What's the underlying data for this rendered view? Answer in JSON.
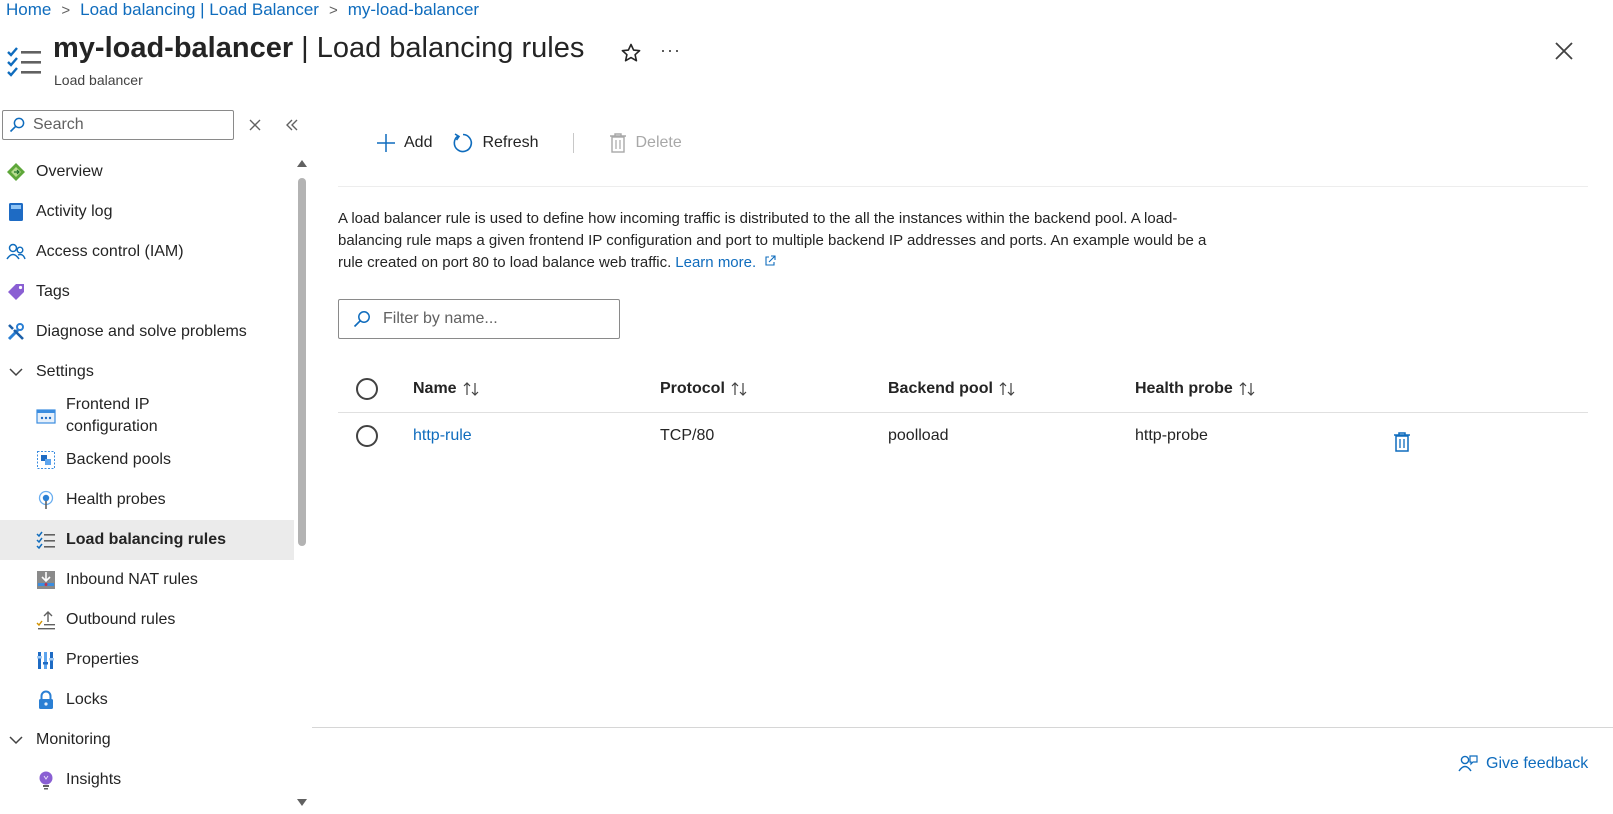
{
  "breadcrumb": [
    {
      "label": "Home"
    },
    {
      "label": "Load balancing | Load Balancer"
    },
    {
      "label": "my-load-balancer"
    }
  ],
  "header": {
    "resource_name": "my-load-balancer",
    "separator": "|",
    "page_name": "Load balancing rules",
    "subtitle": "Load balancer",
    "more_label": "···",
    "icon": "list-checks-icon"
  },
  "sidebar": {
    "search_placeholder": "Search",
    "items": [
      {
        "label": "Overview",
        "icon": "overview-diamond-icon"
      },
      {
        "label": "Activity log",
        "icon": "activity-log-book-icon"
      },
      {
        "label": "Access control (IAM)",
        "icon": "people-icon"
      },
      {
        "label": "Tags",
        "icon": "tag-icon"
      },
      {
        "label": "Diagnose and solve problems",
        "icon": "wrench-icon"
      },
      {
        "label": "Settings",
        "icon": "chevron-down-icon",
        "expanded": true
      },
      {
        "label": "Frontend IP configuration",
        "icon": "frontend-ip-icon"
      },
      {
        "label": "Backend pools",
        "icon": "backend-pool-icon"
      },
      {
        "label": "Health probes",
        "icon": "health-probe-icon"
      },
      {
        "label": "Load balancing rules",
        "icon": "list-checks-icon",
        "selected": true
      },
      {
        "label": "Inbound NAT rules",
        "icon": "inbound-nat-icon"
      },
      {
        "label": "Outbound rules",
        "icon": "outbound-rules-icon"
      },
      {
        "label": "Properties",
        "icon": "properties-bars-icon"
      },
      {
        "label": "Locks",
        "icon": "lock-icon"
      },
      {
        "label": "Monitoring",
        "icon": "chevron-down-icon",
        "expanded": true
      },
      {
        "label": "Insights",
        "icon": "lightbulb-icon"
      }
    ]
  },
  "toolbar": {
    "add_label": "Add",
    "refresh_label": "Refresh",
    "delete_label": "Delete"
  },
  "description": {
    "text": "A load balancer rule is used to define how incoming traffic is distributed to the all the instances within the backend pool. A load-balancing rule maps a given frontend IP configuration and port to multiple backend IP addresses and ports. An example would be a rule created on port 80 to load balance web traffic.",
    "link_label": "Learn more."
  },
  "filter": {
    "placeholder": "Filter by name..."
  },
  "table": {
    "columns": [
      "Name",
      "Protocol",
      "Backend pool",
      "Health probe"
    ],
    "rows": [
      {
        "name": "http-rule",
        "protocol": "TCP/80",
        "backend_pool": "poolload",
        "health_probe": "http-probe"
      }
    ]
  },
  "footer": {
    "feedback_label": "Give feedback"
  },
  "colors": {
    "accent": "#0f6cbd",
    "selected_bg": "#ebebeb",
    "text": "#242424"
  }
}
